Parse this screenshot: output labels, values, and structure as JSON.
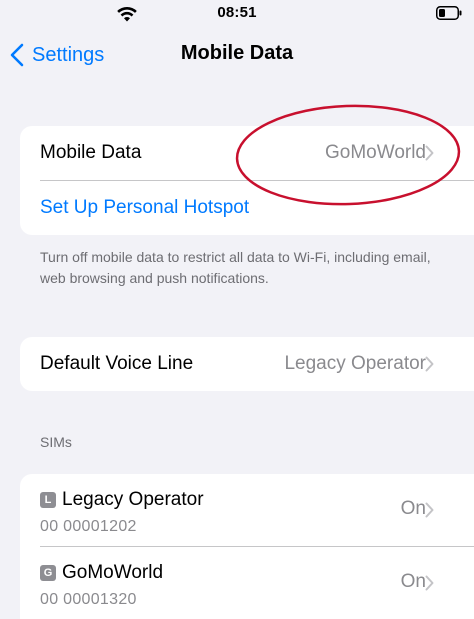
{
  "status_bar": {
    "time": "08:51",
    "wifi_icon": "wifi-icon",
    "battery_icon": "battery-icon"
  },
  "nav": {
    "back_label": "Settings",
    "title": "Mobile Data"
  },
  "mobile_data_group": {
    "mobile_data_label": "Mobile Data",
    "mobile_data_value": "GoMoWorld",
    "hotspot_label": "Set Up Personal Hotspot"
  },
  "footnote": "Turn off mobile data to restrict all data to Wi-Fi, including email, web browsing and push notifications.",
  "voice_group": {
    "label": "Default Voice Line",
    "value": "Legacy Operator"
  },
  "sims": {
    "header": "SIMs",
    "items": [
      {
        "badge": "L",
        "name": "Legacy Operator",
        "number": "00 00001202",
        "status": "On"
      },
      {
        "badge": "G",
        "name": "GoMoWorld",
        "number": "00 00001320",
        "status": "On"
      }
    ]
  },
  "colors": {
    "accent": "#007aff",
    "annotation": "#c8102e",
    "background": "#f2f2f7"
  }
}
